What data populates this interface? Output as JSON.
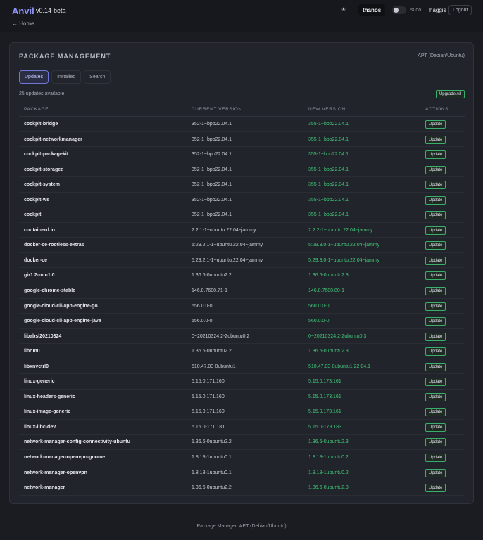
{
  "header": {
    "brand": "Anvil",
    "version": "v0.14-beta",
    "back_link": "← Home",
    "theme_icon": "☀",
    "host": "thanos",
    "sudo_label": "sudo",
    "user": "haggis",
    "logout_label": "Logout"
  },
  "card": {
    "title": "PACKAGE MANAGEMENT",
    "subtitle": "APT (Debian/Ubuntu)",
    "tabs": [
      {
        "label": "Updates",
        "active": true
      },
      {
        "label": "Installed",
        "active": false
      },
      {
        "label": "Search",
        "active": false
      }
    ],
    "count_text": "25 updates available",
    "upgrade_all_label": "Upgrade All",
    "columns": [
      "PACKAGE",
      "CURRENT VERSION",
      "NEW VERSION",
      "ACTIONS"
    ],
    "update_label": "Update",
    "rows": [
      {
        "package": "cockpit-bridge",
        "current": "352-1~bpo22.04.1",
        "new": "355-1~bpo22.04.1"
      },
      {
        "package": "cockpit-networkmanager",
        "current": "352-1~bpo22.04.1",
        "new": "355-1~bpo22.04.1"
      },
      {
        "package": "cockpit-packagekit",
        "current": "352-1~bpo22.04.1",
        "new": "355-1~bpo22.04.1"
      },
      {
        "package": "cockpit-storaged",
        "current": "352-1~bpo22.04.1",
        "new": "355-1~bpo22.04.1"
      },
      {
        "package": "cockpit-system",
        "current": "352-1~bpo22.04.1",
        "new": "355-1~bpo22.04.1"
      },
      {
        "package": "cockpit-ws",
        "current": "352-1~bpo22.04.1",
        "new": "355-1~bpo22.04.1"
      },
      {
        "package": "cockpit",
        "current": "352-1~bpo22.04.1",
        "new": "355-1~bpo22.04.1"
      },
      {
        "package": "containerd.io",
        "current": "2.2.1-1~ubuntu.22.04~jammy",
        "new": "2.2.2-1~ubuntu.22.04~jammy"
      },
      {
        "package": "docker-ce-rootless-extras",
        "current": "5:29.2.1-1~ubuntu.22.04~jammy",
        "new": "5:29.3.0-1~ubuntu.22.04~jammy"
      },
      {
        "package": "docker-ce",
        "current": "5:29.2.1-1~ubuntu.22.04~jammy",
        "new": "5:29.3.0-1~ubuntu.22.04~jammy"
      },
      {
        "package": "gir1.2-nm-1.0",
        "current": "1.36.6-0ubuntu2.2",
        "new": "1.36.6-0ubuntu2.3"
      },
      {
        "package": "google-chrome-stable",
        "current": "146.0.7680.71-1",
        "new": "146.0.7680.80-1"
      },
      {
        "package": "google-cloud-cli-app-engine-go",
        "current": "556.0.0-0",
        "new": "560.0.0-0"
      },
      {
        "package": "google-cloud-cli-app-engine-java",
        "current": "556.0.0-0",
        "new": "560.0.0-0"
      },
      {
        "package": "libabsl20210324",
        "current": "0~20210324.2-2ubuntu0.2",
        "new": "0~20210324.2-2ubuntu0.3"
      },
      {
        "package": "libnm0",
        "current": "1.36.6-0ubuntu2.2",
        "new": "1.36.6-0ubuntu2.3"
      },
      {
        "package": "libxnvctrl0",
        "current": "510.47.03-0ubuntu1",
        "new": "510.47.03-0ubuntu1.22.04.1"
      },
      {
        "package": "linux-generic",
        "current": "5.15.0.171.160",
        "new": "5.15.0.173.161"
      },
      {
        "package": "linux-headers-generic",
        "current": "5.15.0.171.160",
        "new": "5.15.0.173.161"
      },
      {
        "package": "linux-image-generic",
        "current": "5.15.0.171.160",
        "new": "5.15.0.173.161"
      },
      {
        "package": "linux-libc-dev",
        "current": "5.15.0-171.181",
        "new": "5.15.0-173.183"
      },
      {
        "package": "network-manager-config-connectivity-ubuntu",
        "current": "1.36.6-0ubuntu2.2",
        "new": "1.36.6-0ubuntu2.3"
      },
      {
        "package": "network-manager-openvpn-gnome",
        "current": "1.8.18-1ubuntu0.1",
        "new": "1.8.18-1ubuntu0.2"
      },
      {
        "package": "network-manager-openvpn",
        "current": "1.8.18-1ubuntu0.1",
        "new": "1.8.18-1ubuntu0.2"
      },
      {
        "package": "network-manager",
        "current": "1.36.6-0ubuntu2.2",
        "new": "1.36.6-0ubuntu2.3"
      }
    ]
  },
  "footer": {
    "text": "Package Manager: APT (Debian/Ubuntu)"
  },
  "colors": {
    "accent": "#8b93f0",
    "success": "#3fc878",
    "background": "#1b1c22",
    "card": "#22242b"
  }
}
